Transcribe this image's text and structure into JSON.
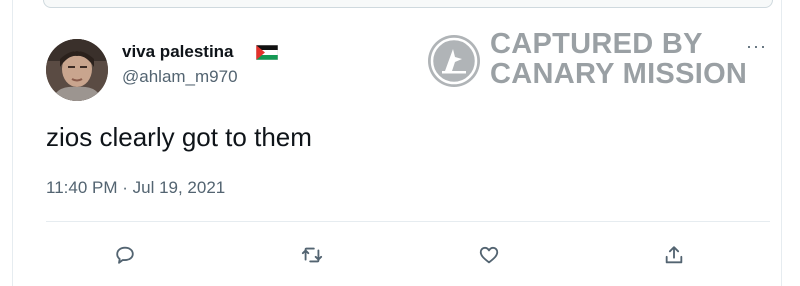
{
  "tweet": {
    "display_name": "viva palestina",
    "handle": "@ahlam_m970",
    "text": "zios clearly got to them",
    "timestamp": "11:40 PM · Jul 19, 2021",
    "more_label": "···"
  },
  "watermark": {
    "line1": "CAPTURED BY",
    "line2": "CANARY MISSION"
  },
  "actions": [
    {
      "name": "reply",
      "icon": "reply-icon"
    },
    {
      "name": "retweet",
      "icon": "retweet-icon"
    },
    {
      "name": "like",
      "icon": "heart-icon"
    },
    {
      "name": "share",
      "icon": "share-icon"
    }
  ],
  "colors": {
    "text_primary": "#0f1419",
    "text_secondary": "#536471",
    "border": "#e6ecf0",
    "watermark": "#9aa0a4"
  }
}
